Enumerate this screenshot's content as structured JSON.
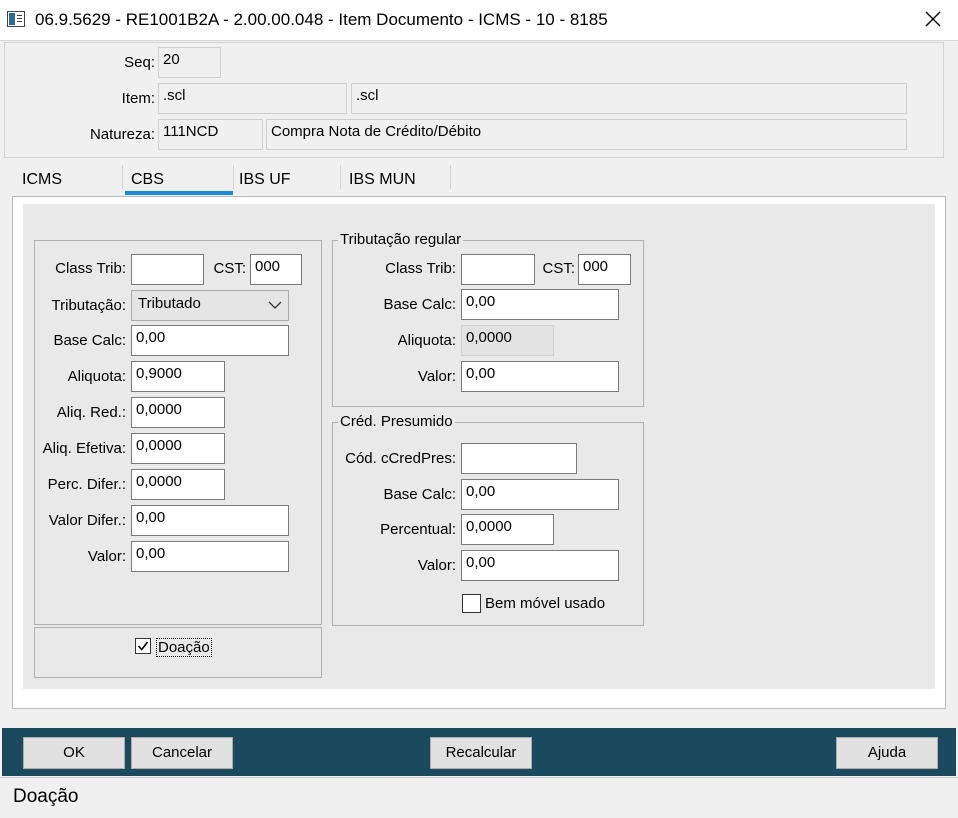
{
  "window": {
    "title": "06.9.5629 - RE1001B2A - 2.00.00.048 - Item Documento - ICMS - 10 - 8185"
  },
  "header": {
    "seq_label": "Seq:",
    "seq_value": "20",
    "item_label": "Item:",
    "item_code": ".scl",
    "item_desc": ".scl",
    "natureza_label": "Natureza:",
    "natureza_code": "111NCD",
    "natureza_desc": "Compra Nota de Crédito/Débito"
  },
  "tabs": [
    {
      "label": "ICMS",
      "selected": false
    },
    {
      "label": "CBS",
      "selected": true
    },
    {
      "label": "IBS UF",
      "selected": false
    },
    {
      "label": "IBS MUN",
      "selected": false
    }
  ],
  "cbs": {
    "class_trib_label": "Class Trib:",
    "class_trib_value": "",
    "cst_label": "CST:",
    "cst_value": "000",
    "tributacao_label": "Tributação:",
    "tributacao_value": "Tributado",
    "base_calc_label": "Base Calc:",
    "base_calc_value": "0,00",
    "aliquota_label": "Aliquota:",
    "aliquota_value": "0,9000",
    "aliq_red_label": "Aliq. Red.:",
    "aliq_red_value": "0,0000",
    "aliq_efetiva_label": "Aliq. Efetiva:",
    "aliq_efetiva_value": "0,0000",
    "perc_difer_label": "Perc. Difer.:",
    "perc_difer_value": "0,0000",
    "valor_difer_label": "Valor Difer.:",
    "valor_difer_value": "0,00",
    "valor_label": "Valor:",
    "valor_value": "0,00",
    "doacao_label": "Doação",
    "doacao_checked": true
  },
  "tributacao_regular": {
    "legend": "Tributação regular",
    "class_trib_label": "Class Trib:",
    "class_trib_value": "",
    "cst_label": "CST:",
    "cst_value": "000",
    "base_calc_label": "Base Calc:",
    "base_calc_value": "0,00",
    "aliquota_label": "Aliquota:",
    "aliquota_value": "0,0000",
    "valor_label": "Valor:",
    "valor_value": "0,00"
  },
  "cred_presumido": {
    "legend": "Créd. Presumido",
    "cod_label": "Cód. cCredPres:",
    "cod_value": "",
    "base_calc_label": "Base Calc:",
    "base_calc_value": "0,00",
    "percentual_label": "Percentual:",
    "percentual_value": "0,0000",
    "valor_label": "Valor:",
    "valor_value": "0,00",
    "bem_movel_label": "Bem móvel usado",
    "bem_movel_checked": false
  },
  "buttons": {
    "ok": "OK",
    "cancelar": "Cancelar",
    "recalcular": "Recalcular",
    "ajuda": "Ajuda"
  },
  "status_bar": {
    "text": "Doação"
  },
  "colors": {
    "footer_bg": "#1b4a5f",
    "tab_indicator": "#1e8bd6"
  }
}
